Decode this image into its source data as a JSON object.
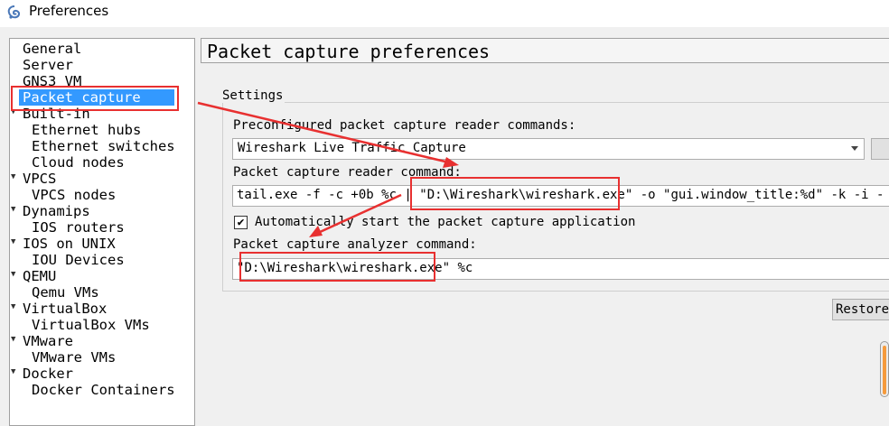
{
  "window": {
    "title": "Preferences",
    "icon": "gns3-app-icon"
  },
  "sidebar": {
    "items": [
      {
        "label": "General",
        "level": 0,
        "expandable": false,
        "selected": false
      },
      {
        "label": "Server",
        "level": 0,
        "expandable": false,
        "selected": false
      },
      {
        "label": "GNS3 VM",
        "level": 0,
        "expandable": false,
        "selected": false
      },
      {
        "label": "Packet capture",
        "level": 0,
        "expandable": false,
        "selected": true
      },
      {
        "label": "Built-in",
        "level": 0,
        "expandable": true,
        "selected": false
      },
      {
        "label": "Ethernet hubs",
        "level": 1,
        "expandable": false,
        "selected": false
      },
      {
        "label": "Ethernet switches",
        "level": 1,
        "expandable": false,
        "selected": false
      },
      {
        "label": "Cloud nodes",
        "level": 1,
        "expandable": false,
        "selected": false
      },
      {
        "label": "VPCS",
        "level": 0,
        "expandable": true,
        "selected": false
      },
      {
        "label": "VPCS nodes",
        "level": 1,
        "expandable": false,
        "selected": false
      },
      {
        "label": "Dynamips",
        "level": 0,
        "expandable": true,
        "selected": false
      },
      {
        "label": "IOS routers",
        "level": 1,
        "expandable": false,
        "selected": false
      },
      {
        "label": "IOS on UNIX",
        "level": 0,
        "expandable": true,
        "selected": false
      },
      {
        "label": "IOU Devices",
        "level": 1,
        "expandable": false,
        "selected": false
      },
      {
        "label": "QEMU",
        "level": 0,
        "expandable": true,
        "selected": false
      },
      {
        "label": "Qemu VMs",
        "level": 1,
        "expandable": false,
        "selected": false
      },
      {
        "label": "VirtualBox",
        "level": 0,
        "expandable": true,
        "selected": false
      },
      {
        "label": "VirtualBox VMs",
        "level": 1,
        "expandable": false,
        "selected": false
      },
      {
        "label": "VMware",
        "level": 0,
        "expandable": true,
        "selected": false
      },
      {
        "label": "VMware VMs",
        "level": 1,
        "expandable": false,
        "selected": false
      },
      {
        "label": "Docker",
        "level": 0,
        "expandable": true,
        "selected": false
      },
      {
        "label": "Docker Containers",
        "level": 1,
        "expandable": false,
        "selected": false
      }
    ]
  },
  "main": {
    "header_title": "Packet capture preferences",
    "group_title": "Settings",
    "preconfigured_label": "Preconfigured packet capture reader commands:",
    "preconfigured_value": "Wireshark Live Traffic Capture",
    "reader_label": "Packet capture reader command:",
    "reader_prefix": "tail.exe -f -c +0b %c | \"",
    "reader_path": "D:\\Wireshark\\wireshark.exe",
    "reader_suffix": "\" -o \"gui.window_title:%d\" -k -i -",
    "autostart_label": "Automatically start the packet capture application",
    "autostart_checked": "✔",
    "analyzer_label": "Packet capture analyzer command:",
    "analyzer_prefix": "\"",
    "analyzer_path": "D:\\Wireshark\\wireshark.exe",
    "analyzer_suffix": "\" %c",
    "restore_label": "Restore"
  },
  "colors": {
    "selection": "#3399ff",
    "annotation": "#e83030",
    "scroll_accent": "#f59a3c"
  }
}
